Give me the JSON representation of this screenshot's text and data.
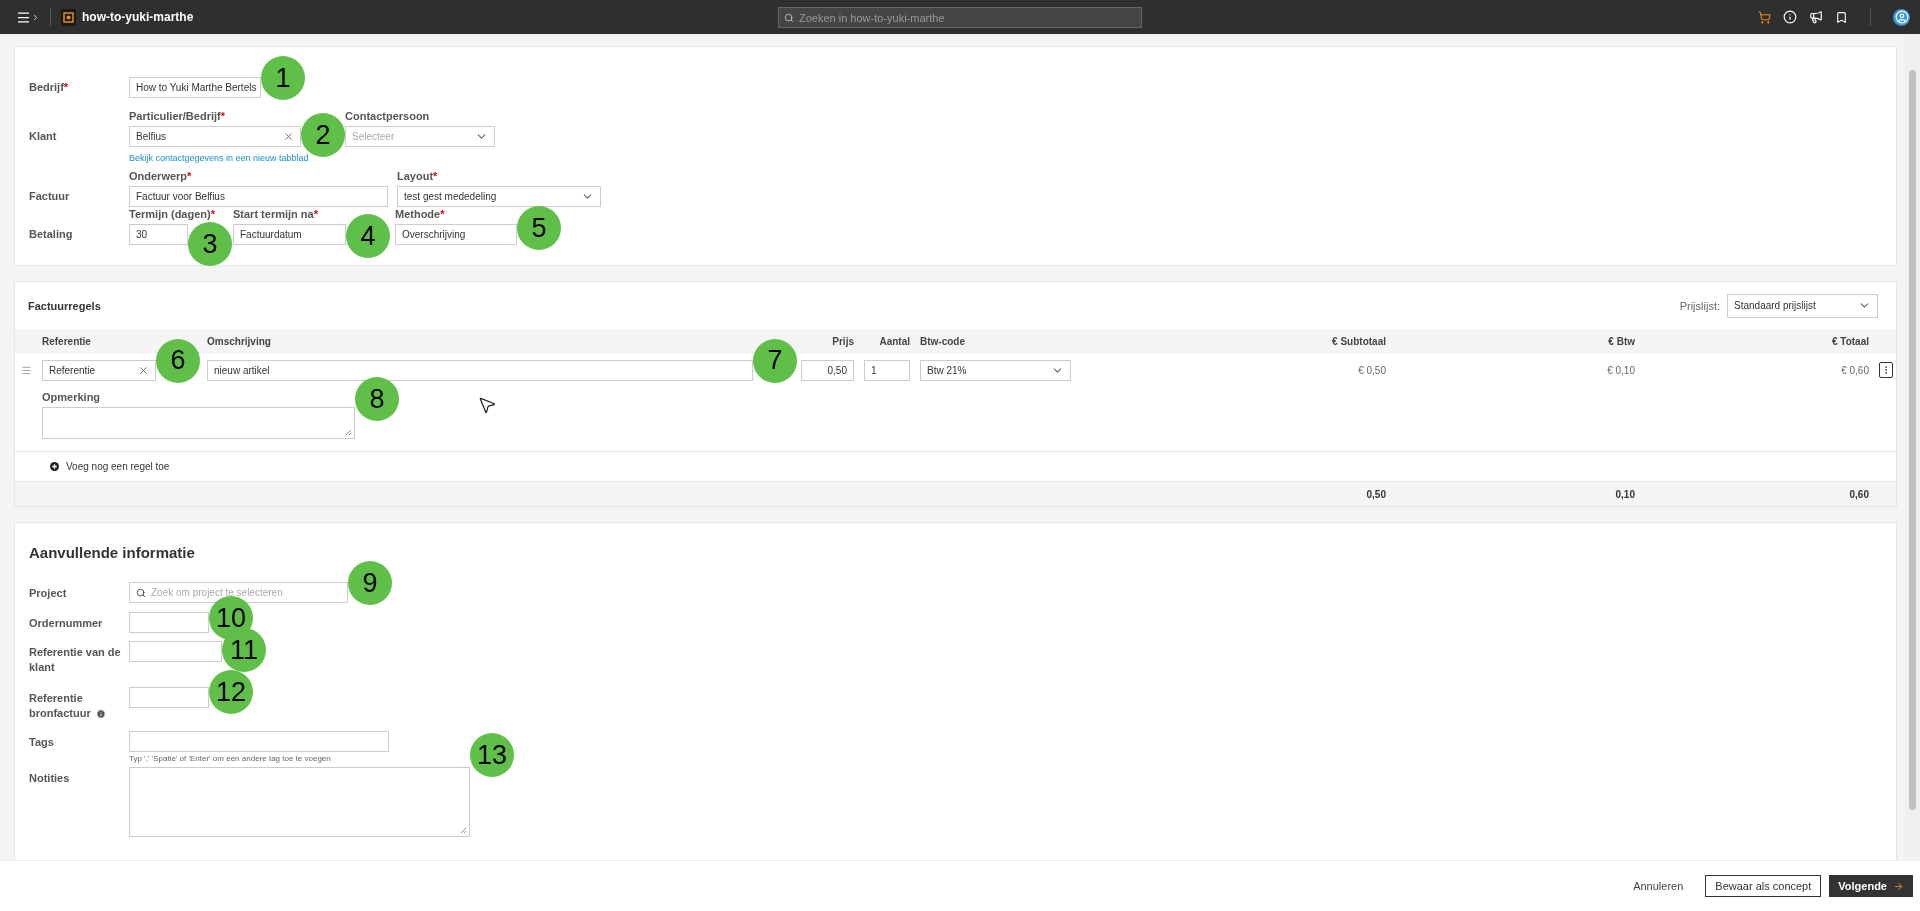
{
  "topbar": {
    "app_name": "how-to-yuki-marthe",
    "search_placeholder": "Zoeken in how-to-yuki-marthe"
  },
  "general": {
    "bedrijf": {
      "label": "Bedrijf",
      "mark": "*",
      "kind": "text",
      "value": "How to Yuki Marthe Bertels",
      "marker": "1"
    },
    "klant": {
      "label": "Klant",
      "customer": {
        "label": "Particulier/Bedrijf",
        "mark": "*",
        "kind": "clearable",
        "value": "Belfius",
        "marker": "2"
      },
      "contact": {
        "label": "Contactpersoon",
        "kind": "select",
        "placeholder": "Selecteer"
      },
      "link": "Bekijk contactgegevens in een nieuw tabblad"
    },
    "factuur": {
      "label": "Factuur",
      "subject": {
        "label": "Onderwerp",
        "mark": "*",
        "kind": "text",
        "value": "Factuur voor Belfius"
      },
      "layout": {
        "label": "Layout",
        "mark": "*",
        "kind": "select",
        "value": "test gest mededeling"
      }
    },
    "betaling": {
      "label": "Betaling",
      "term": {
        "label": "Termijn (dagen)",
        "mark": "*",
        "kind": "text",
        "value": "30",
        "marker": "3"
      },
      "start": {
        "label": "Start termijn na",
        "mark": "*",
        "kind": "text",
        "value": "Factuurdatum",
        "marker": "4"
      },
      "method": {
        "label": "Methode",
        "mark": "*",
        "kind": "text",
        "value": "Overschrijving",
        "marker": "5"
      }
    }
  },
  "invoice_lines": {
    "title": "Factuurregels",
    "price_list": {
      "label": "Prijslijst:",
      "value": "Standaard prijslijst"
    },
    "columns": [
      "Referentie",
      "Omschrijving",
      "Prijs",
      "Aantal",
      "Btw-code",
      "€ Subtotaal",
      "€ Btw",
      "€ Totaal"
    ],
    "lines": [
      {
        "reference": "Referentie",
        "reference_marker": "6",
        "description": "nieuw artikel",
        "description_marker": "7",
        "price": "0,50",
        "quantity": "1",
        "vat_code": "Btw 21%",
        "subtotal": "€ 0,50",
        "vat": "€ 0,10",
        "total": "€ 0,60",
        "remark_label": "Opmerking",
        "remark_marker": "8"
      }
    ],
    "add_line": "Voeg nog een regel toe",
    "totals": [
      "0,50",
      "0,10",
      "0,60"
    ]
  },
  "extra": {
    "title": "Aanvullende informatie",
    "fields": [
      {
        "label": "Project",
        "kind": "search",
        "placeholder": "Zoek om project te selecteren",
        "marker": "9"
      },
      {
        "label": "Ordernummer",
        "kind": "short",
        "marker": "10"
      },
      {
        "label": "Referentie van de klant",
        "kind": "short",
        "marker": "11"
      },
      {
        "label": "Referentie bronfactuur",
        "kind": "short",
        "info": true,
        "marker": "12"
      },
      {
        "label": "Tags",
        "kind": "text",
        "hint": "Typ ',' 'Spatie' of 'Enter' om een andere tag toe te voegen"
      },
      {
        "label": "Notities",
        "kind": "textarea",
        "marker": "13"
      }
    ]
  },
  "footer": {
    "cancel": "Annuleren",
    "draft": "Bewaar als concept",
    "next": "Volgende"
  }
}
